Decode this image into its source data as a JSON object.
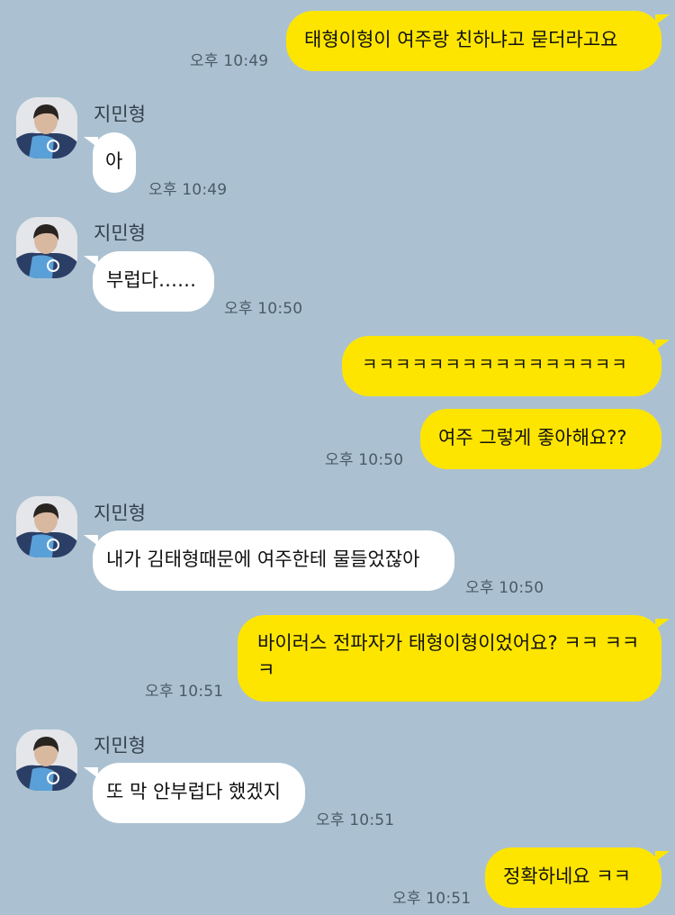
{
  "chat": {
    "messages": [
      {
        "sender": "me",
        "text": "태형이형이 여주랑 친하냐고 묻더라고요",
        "time": "오후 10:49"
      },
      {
        "sender": "them",
        "name": "지민형",
        "text": "아",
        "time": "오후 10:49"
      },
      {
        "sender": "them",
        "name": "지민형",
        "text": "부럽다……",
        "time": "오후 10:50"
      },
      {
        "sender": "me",
        "text": "ㅋㅋㅋㅋㅋㅋㅋㅋㅋㅋㅋㅋㅋㅋㅋㅋ",
        "time": ""
      },
      {
        "sender": "me",
        "text": "여주 그렇게 좋아해요??",
        "time": "오후 10:50"
      },
      {
        "sender": "them",
        "name": "지민형",
        "text": "내가 김태형때문에 여주한테 물들었잖아",
        "time": "오후 10:50"
      },
      {
        "sender": "me",
        "text": "바이러스 전파자가 태형이형이었어요? ㅋㅋ ㅋㅋㅋ",
        "time": "오후 10:51"
      },
      {
        "sender": "them",
        "name": "지민형",
        "text": "또 막 안부럽다 했겠지",
        "time": "오후 10:51"
      },
      {
        "sender": "me",
        "text": "정확하네요 ㅋㅋ",
        "time": "오후 10:51"
      }
    ]
  },
  "colors": {
    "background": "#abc1d1",
    "my_bubble": "#fee500",
    "their_bubble": "#ffffff",
    "time_text": "#4a5a66"
  },
  "icons": {
    "avatar": "profile-photo-icon"
  }
}
